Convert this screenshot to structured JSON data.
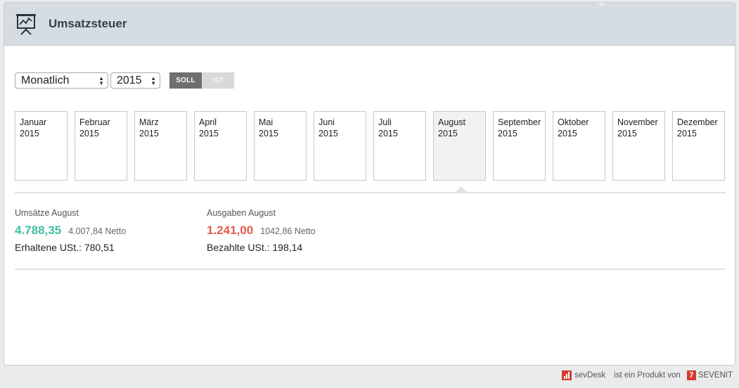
{
  "header": {
    "title": "Umsatzsteuer"
  },
  "controls": {
    "period_select": "Monatlich",
    "year_select": "2015",
    "toggle": {
      "soll": "SOLL",
      "ist": "IST"
    }
  },
  "months": [
    {
      "name": "Januar",
      "year": "2015"
    },
    {
      "name": "Februar",
      "year": "2015"
    },
    {
      "name": "März",
      "year": "2015"
    },
    {
      "name": "April",
      "year": "2015"
    },
    {
      "name": "Mai",
      "year": "2015"
    },
    {
      "name": "Juni",
      "year": "2015"
    },
    {
      "name": "Juli",
      "year": "2015"
    },
    {
      "name": "August",
      "year": "2015"
    },
    {
      "name": "September",
      "year": "2015"
    },
    {
      "name": "Oktober",
      "year": "2015"
    },
    {
      "name": "November",
      "year": "2015"
    },
    {
      "name": "Dezember",
      "year": "2015"
    }
  ],
  "selected_month": "August",
  "revenue": {
    "label": "Umsätze August",
    "amount": "4.788,35",
    "netto": "4.007,84 Netto",
    "vat_label": "Erhaltene USt.: 780,51"
  },
  "expenses": {
    "label": "Ausgaben August",
    "amount": "1.241,00",
    "netto": "1042,86 Netto",
    "vat_label": "Bezahlte USt.: 198,14"
  },
  "footer": {
    "brand": "sevDesk",
    "middle": "ist ein Produkt von",
    "company": "SEVENIT",
    "company_logo": "7"
  },
  "colors": {
    "revenue": "#3fbfa3",
    "expenses": "#e45a4e",
    "brand": "#d43a2f"
  }
}
